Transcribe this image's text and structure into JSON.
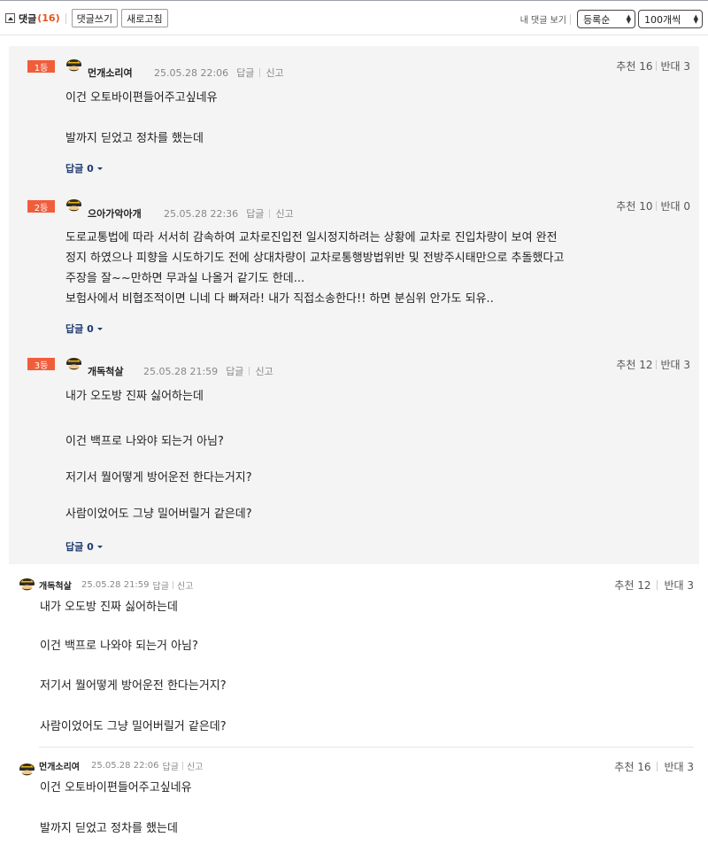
{
  "toolbar": {
    "title": "댓글",
    "count": "(16)",
    "write_label": "댓글쓰기",
    "refresh_label": "새로고침",
    "my_comments_label": "내 댓글 보기",
    "sort_value": "등록순",
    "per_page_value": "100개씩"
  },
  "best_comments": [
    {
      "rank": "1등",
      "nick": "먼개소리여",
      "date": "25.05.28 22:06",
      "reply_label": "답글",
      "report_label": "신고",
      "up_label": "추천 16",
      "down_label": "반대 3",
      "lines": [
        "이건 오토바이편들어주고싶네유",
        "",
        "발까지 딛었고 정차를 했는데"
      ],
      "replies_label": "답글 0"
    },
    {
      "rank": "2등",
      "nick": "으아가악아개",
      "date": "25.05.28 22:36",
      "reply_label": "답글",
      "report_label": "신고",
      "up_label": "추천 10",
      "down_label": "반대 0",
      "lines": [
        "도로교통법에 따라 서서히 감속하여 교차로진입전 일시정지하려는 상황에 교차로 진입차량이 보여 완전",
        "정지 하였으나 피향을 시도하기도 전에 상대차량이 교차로통행방법위반 및 전방주시태만으로 추돌했다고",
        "주장을 잘~~만하면 무과실 나올거 같기도 한데...",
        "보험사에서 비협조적이면 니네 다 빠져라! 내가 직접소송한다!! 하면 분심위 안가도 되유.."
      ],
      "replies_label": "답글 0"
    },
    {
      "rank": "3등",
      "nick": "개독척살",
      "date": "25.05.28 21:59",
      "reply_label": "답글",
      "report_label": "신고",
      "up_label": "추천 12",
      "down_label": "반대 3",
      "lines": [
        "내가 오도방 진짜 싫어하는데",
        "",
        "이건 백프로 나와야 되는거 아님?",
        "",
        "저기서 뭘어떻게 방어운전 한다는거지?",
        "",
        "사람이었어도 그냥 밀어버릴거 같은데?"
      ],
      "replies_label": "답글 0"
    }
  ],
  "comments": [
    {
      "nick": "개독척살",
      "date": "25.05.28 21:59",
      "reply_label": "답글",
      "report_label": "신고",
      "up_label": "추천 12",
      "down_label": "반대 3",
      "lines": [
        "내가 오도방 진짜 싫어하는데",
        "",
        "이건 백프로 나와야 되는거 아님?",
        "",
        "저기서 뭘어떻게 방어운전 한다는거지?",
        "",
        "사람이었어도 그냥 밀어버릴거 같은데?"
      ]
    },
    {
      "nick": "먼개소리여",
      "date": "25.05.28 22:06",
      "reply_label": "답글",
      "report_label": "신고",
      "up_label": "추천 16",
      "down_label": "반대 3",
      "lines": [
        "이건 오토바이편들어주고싶네유",
        "",
        "발까지 딛었고 정차를 했는데"
      ]
    }
  ],
  "colors": {
    "rank_badge": "#f15d3b",
    "count": "#e8541e",
    "reply_link": "#1f3a6e",
    "best_bg": "#f4f4f4"
  },
  "icons": {
    "avatar": "helmet-avatar-icon",
    "collapse": "collapse-toggle-icon"
  }
}
